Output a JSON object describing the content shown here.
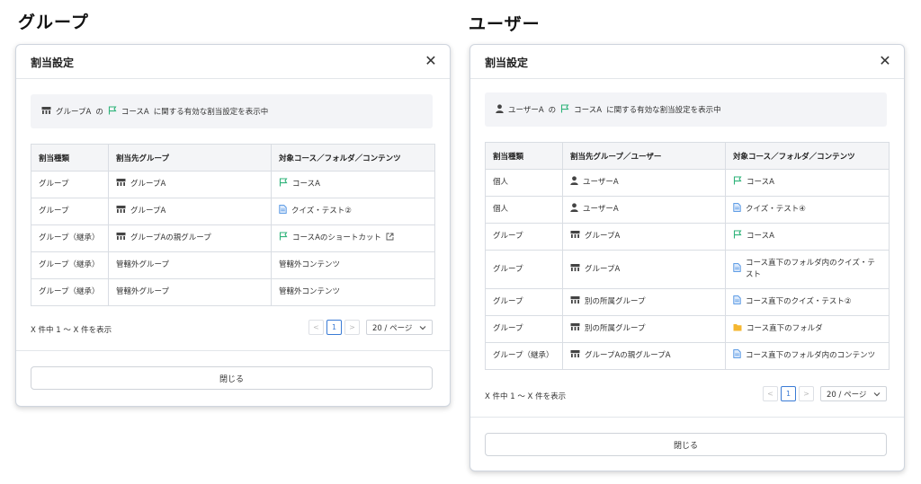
{
  "labels": {
    "group": "グループ",
    "user": "ユーザー"
  },
  "colors": {
    "course_flag": "#2fb37a",
    "doc": "#4a90e2",
    "folder": "#f5b731",
    "accent": "#3a7bd5"
  },
  "left": {
    "modal_title": "割当設定",
    "close_glyph": "✕",
    "info": {
      "subject": "グループA",
      "of": "の",
      "course": "コースA",
      "rest": "に関する有効な割当設定を表示中"
    },
    "headers": [
      "割当種類",
      "割当先グループ",
      "対象コース／フォルダ／コンテンツ"
    ],
    "rows": [
      {
        "type": "グループ",
        "target_icon": "group",
        "target": "グループA",
        "obj_icon": "flag",
        "obj": "コースA",
        "external": false
      },
      {
        "type": "グループ",
        "target_icon": "group",
        "target": "グループA",
        "obj_icon": "doc",
        "obj": "クイズ・テスト②",
        "external": false
      },
      {
        "type": "グループ（継承）",
        "target_icon": "group",
        "target": "グループAの親グループ",
        "obj_icon": "flag",
        "obj": "コースAのショートカット",
        "external": true
      },
      {
        "type": "グループ（継承）",
        "target_icon": "none",
        "target": "管轄外グループ",
        "obj_icon": "none",
        "obj": "管轄外コンテンツ",
        "external": false
      },
      {
        "type": "グループ（継承）",
        "target_icon": "none",
        "target": "管轄外グループ",
        "obj_icon": "none",
        "obj": "管轄外コンテンツ",
        "external": false
      }
    ],
    "range_text": "X 件中 1 ～ X 件を表示",
    "pager": {
      "prev": "<",
      "page": "1",
      "next": ">",
      "size": "20 / ページ"
    },
    "close_button": "閉じる"
  },
  "right": {
    "modal_title": "割当設定",
    "close_glyph": "✕",
    "info": {
      "subject": "ユーザーA",
      "of": "の",
      "course": "コースA",
      "rest": "に関する有効な割当設定を表示中"
    },
    "headers": [
      "割当種類",
      "割当先グループ／ユーザー",
      "対象コース／フォルダ／コンテンツ"
    ],
    "rows": [
      {
        "type": "個人",
        "target_icon": "user",
        "target": "ユーザーA",
        "obj_icon": "flag",
        "obj": "コースA",
        "external": false
      },
      {
        "type": "個人",
        "target_icon": "user",
        "target": "ユーザーA",
        "obj_icon": "doc",
        "obj": "クイズ・テスト④",
        "external": false
      },
      {
        "type": "グループ",
        "target_icon": "group",
        "target": "グループA",
        "obj_icon": "flag",
        "obj": "コースA",
        "external": false
      },
      {
        "type": "グループ",
        "target_icon": "group",
        "target": "グループA",
        "obj_icon": "doc",
        "obj": "コース直下のフォルダ内のクイズ・テスト",
        "external": false,
        "tall": true
      },
      {
        "type": "グループ",
        "target_icon": "group",
        "target": "別の所属グループ",
        "obj_icon": "doc",
        "obj": "コース直下のクイズ・テスト②",
        "external": false
      },
      {
        "type": "グループ",
        "target_icon": "group",
        "target": "別の所属グループ",
        "obj_icon": "folder",
        "obj": "コース直下のフォルダ",
        "external": false
      },
      {
        "type": "グループ（継承）",
        "target_icon": "group",
        "target": "グループAの親グループA",
        "obj_icon": "doc",
        "obj": "コース直下のフォルダ内のコンテンツ",
        "external": false
      }
    ],
    "range_text": "X 件中 1 ～ X 件を表示",
    "pager": {
      "prev": "<",
      "page": "1",
      "next": ">",
      "size": "20 / ページ"
    },
    "close_button": "閉じる"
  }
}
